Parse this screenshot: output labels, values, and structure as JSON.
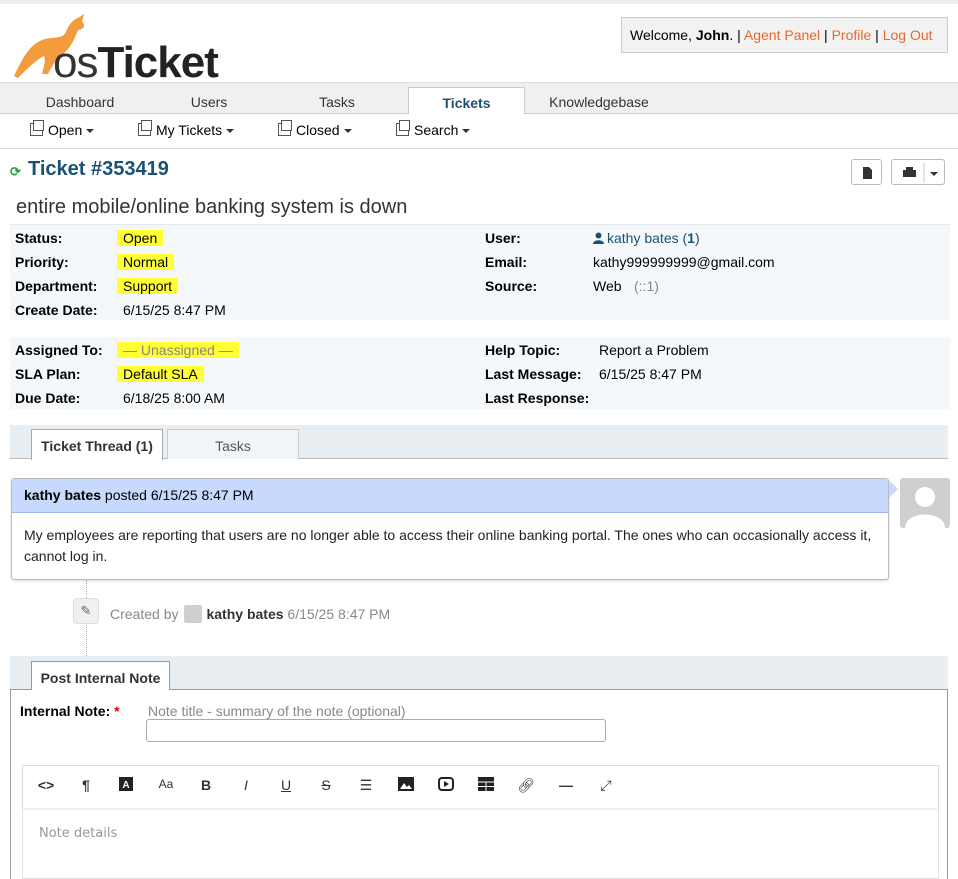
{
  "header": {
    "logo_text_os": "os",
    "logo_text_ticket": "Ticket",
    "welcome_prefix": "Welcome, ",
    "user_name": "John",
    "welcome_suffix": ". | ",
    "agent_panel": "Agent Panel",
    "sep": " | ",
    "profile": "Profile",
    "logout": "Log Out"
  },
  "nav": {
    "tabs": [
      {
        "label": "Dashboard"
      },
      {
        "label": "Users"
      },
      {
        "label": "Tasks"
      },
      {
        "label": "Tickets",
        "active": true
      },
      {
        "label": "Knowledgebase"
      }
    ]
  },
  "subnav": {
    "items": [
      {
        "label": "Open"
      },
      {
        "label": "My Tickets"
      },
      {
        "label": "Closed"
      },
      {
        "label": "Search"
      }
    ]
  },
  "ticket": {
    "number": "Ticket #353419",
    "subject": "entire mobile/online banking system is down",
    "status_label": "Status:",
    "status": "Open",
    "priority_label": "Priority:",
    "priority": "Normal",
    "department_label": "Department:",
    "department": "Support",
    "create_date_label": "Create Date:",
    "create_date": "6/15/25 8:47 PM",
    "user_label": "User:",
    "user": "kathy bates",
    "user_count_open": " (",
    "user_count": "1",
    "user_count_close": ")",
    "email_label": "Email:",
    "email": "kathy999999999@gmail.com",
    "source_label": "Source:",
    "source": "Web",
    "source_ip": "(::1)",
    "assigned_label": "Assigned To:",
    "assigned": "— Unassigned —",
    "sla_label": "SLA Plan:",
    "sla": "Default SLA",
    "due_label": "Due Date:",
    "due": "6/18/25 8:00 AM",
    "help_topic_label": "Help Topic:",
    "help_topic": "Report a Problem",
    "last_message_label": "Last Message:",
    "last_message": "6/15/25 8:47 PM",
    "last_response_label": "Last Response:",
    "last_response": ""
  },
  "thread_tabs": [
    {
      "label": "Ticket Thread (1)",
      "active": true
    },
    {
      "label": "Tasks"
    }
  ],
  "message": {
    "author": "kathy bates",
    "posted": " posted 6/15/25 8:47 PM",
    "body": "My employees are reporting that users are no longer able to access their online banking portal. The ones who can occasionally access it, cannot log in."
  },
  "event": {
    "prefix": "Created by",
    "author": "kathy bates",
    "date": "6/15/25 8:47 PM"
  },
  "note": {
    "tab": "Post Internal Note",
    "label": "Internal Note:",
    "required_mark": "*",
    "title_hint": "Note title - summary of the note (optional)",
    "details_placeholder": "Note details"
  },
  "colors": {
    "accent": "#e8692a",
    "link": "#1a5276",
    "highlight": "#ffff33",
    "message_header": "#c7dafd"
  }
}
